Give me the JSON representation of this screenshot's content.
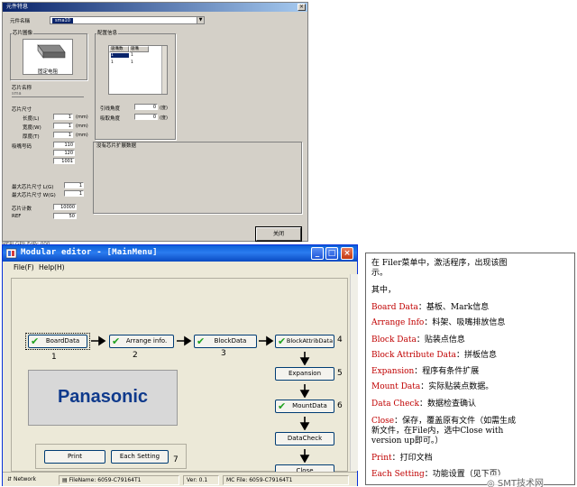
{
  "parts_dialog": {
    "title": "元件特息",
    "part_name_label": "元件名稱",
    "part_name_value": "sma10",
    "chip_image_label": "芯片圖像",
    "chip_image_caption": "固定电阻",
    "pickup_group_label": "配置信息",
    "table_headers": [
      "吸嘴数",
      "吸嘴"
    ],
    "table_rows": [
      [
        "1",
        "1"
      ],
      [
        "1",
        "1"
      ]
    ],
    "lead_angle_label": "引线角度",
    "lead_angle_value": "0",
    "lead_angle_unit": "(度)",
    "pickup_angle_label": "吸取角度",
    "pickup_angle_value": "0",
    "pickup_angle_unit": "(度)",
    "chip_name_label": "芯片名称",
    "chip_name_value": "sma",
    "chip_size_label": "芯片尺寸",
    "length_label": "长度(L)",
    "length_value": "1",
    "length_unit": "(mm)",
    "width_label": "宽度(W)",
    "width_value": "1",
    "width_unit": "(mm)",
    "thickness_label": "厚度(T)",
    "thickness_value": "1",
    "thickness_unit": "(mm)",
    "nozzle_label": "吸嘴号码",
    "nozzle_values": [
      "110",
      "120",
      "1001"
    ],
    "max_size_l_label": "最大芯片尺寸 L(G)",
    "max_size_l_value": "1",
    "max_size_w_label": "最大芯片尺寸 W(G)",
    "max_size_w_value": "1",
    "chip_count_label": "芯片计数",
    "chip_count_value": "10000",
    "ref_label": "REF",
    "ref_value": "50",
    "extension_label": "没有芯片扩展数据",
    "ok_button": "关闭",
    "under_text": "MERLGPlt FdPc 000"
  },
  "modular_editor": {
    "title": "Modular editor - [MainMenu]",
    "menu": [
      "File(F)",
      "Help(H)"
    ],
    "buttons": {
      "board_data": "BoardData",
      "arrange_info": "Arrange info.",
      "block_data": "BlockData",
      "block_attrib_data": "BlockAttribData",
      "expansion": "Expansion",
      "mount_data": "MountData",
      "data_check": "DataCheck",
      "close": "Close",
      "print": "Print",
      "each_setting": "Each Setting"
    },
    "numbers": [
      "1",
      "2",
      "3",
      "4",
      "5",
      "6",
      "7"
    ],
    "logo_text": "Panasonic",
    "status": {
      "network": "Network",
      "file_name": "FileName: 6059-C79164T1",
      "ver": "Ver: 0.1",
      "mc_file": "MC File: 6059-C79164T1"
    }
  },
  "notes": {
    "intro_1": "在 Filer菜单中，激活程序，出现该图",
    "intro_2": "示。",
    "among": "其中，",
    "items": [
      {
        "term": "Board Data",
        "desc": "：基板、Mark信息"
      },
      {
        "term": "Arrange Info",
        "desc": "：料架、吸嘴排放信息"
      },
      {
        "term": "Block Data",
        "desc": "：贴装点信息"
      },
      {
        "term": "Block Attribute Data",
        "desc": "：拼板信息"
      },
      {
        "term": "Expansion",
        "desc": "：程序有条件扩展"
      },
      {
        "term": "Mount Data",
        "desc": "：实际贴装点数据。"
      },
      {
        "term": "Data Check",
        "desc": "：数据检查确认"
      }
    ],
    "close_term": "Close",
    "close_desc_1": "：保存，覆盖原有文件（如需生成",
    "close_desc_2": "新文件，在File内，选中Close with",
    "close_desc_3": "version up即可。）",
    "print_term": "Print",
    "print_desc": "：打印文档",
    "each_term": "Each Setting",
    "each_desc": "：功能设置（见下页）"
  },
  "watermark": "SMT技术网"
}
